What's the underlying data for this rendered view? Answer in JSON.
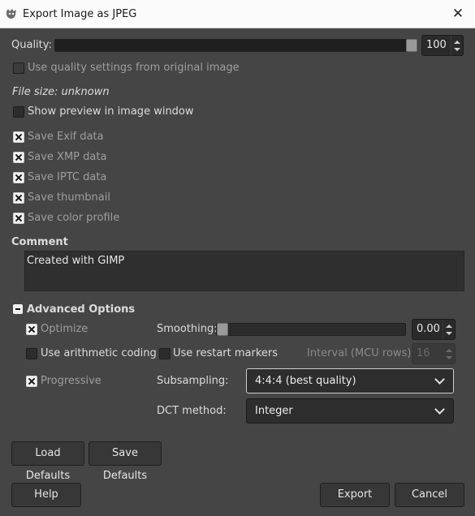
{
  "window": {
    "title": "Export Image as JPEG",
    "close_glyph": "✕"
  },
  "quality": {
    "label": "Quality:",
    "value": "100",
    "fraction": 1.0
  },
  "use_original_quality": {
    "label": "Use quality settings from original image",
    "checked": false
  },
  "file_size": "File size: unknown",
  "show_preview": {
    "label": "Show preview in image window",
    "checked": false
  },
  "metadata_options": [
    {
      "label": "Save Exif data",
      "checked": true
    },
    {
      "label": "Save XMP data",
      "checked": true
    },
    {
      "label": "Save IPTC data",
      "checked": true
    },
    {
      "label": "Save thumbnail",
      "checked": true
    },
    {
      "label": "Save color profile",
      "checked": true
    }
  ],
  "comment": {
    "heading": "Comment",
    "text": "Created with GIMP"
  },
  "advanced": {
    "heading": "Advanced Options",
    "optimize": {
      "label": "Optimize",
      "checked": true
    },
    "arithmetic": {
      "label": "Use arithmetic coding",
      "checked": false
    },
    "restart_markers": {
      "label": "Use restart markers",
      "checked": false
    },
    "interval": {
      "label": "Interval (MCU rows):",
      "value": "16"
    },
    "progressive": {
      "label": "Progressive",
      "checked": true
    },
    "smoothing": {
      "label": "Smoothing:",
      "value": "0.00",
      "fraction": 0.0
    },
    "subsampling": {
      "label": "Subsampling:",
      "selected": "4:4:4 (best quality)"
    },
    "dct": {
      "label": "DCT method:",
      "selected": "Integer"
    }
  },
  "buttons": {
    "load_defaults": "Load Defaults",
    "save_defaults": "Save Defaults",
    "help": "Help",
    "export": "Export",
    "cancel": "Cancel"
  },
  "colors": {
    "background": "#454545",
    "titlebar": "#fbfbfb",
    "text": "#dcdcdc"
  }
}
